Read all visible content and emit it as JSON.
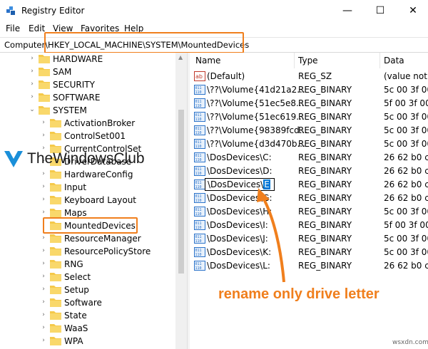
{
  "window": {
    "title": "Registry Editor",
    "min": "—",
    "max": "☐",
    "close": "✕"
  },
  "menu": [
    "File",
    "Edit",
    "View",
    "Favorites",
    "Help"
  ],
  "address": {
    "prefix": "Computer\\",
    "path": "HKEY_LOCAL_MACHINE\\SYSTEM\\MountedDevices"
  },
  "tree": [
    {
      "label": "HARDWARE",
      "level": 1,
      "chevron": "›"
    },
    {
      "label": "SAM",
      "level": 1,
      "chevron": "›"
    },
    {
      "label": "SECURITY",
      "level": 1,
      "chevron": "›"
    },
    {
      "label": "SOFTWARE",
      "level": 1,
      "chevron": "›"
    },
    {
      "label": "SYSTEM",
      "level": 1,
      "chevron": "⌄"
    },
    {
      "label": "ActivationBroker",
      "level": 2,
      "chevron": "›"
    },
    {
      "label": "ControlSet001",
      "level": 2,
      "chevron": "›"
    },
    {
      "label": "CurrentControlSet",
      "level": 2,
      "chevron": "›"
    },
    {
      "label": "DriverDatabase",
      "level": 2,
      "chevron": "›"
    },
    {
      "label": "HardwareConfig",
      "level": 2,
      "chevron": "›"
    },
    {
      "label": "Input",
      "level": 2,
      "chevron": "›"
    },
    {
      "label": "Keyboard Layout",
      "level": 2,
      "chevron": "›"
    },
    {
      "label": "Maps",
      "level": 2,
      "chevron": "›"
    },
    {
      "label": "MountedDevices",
      "level": 2,
      "chevron": ""
    },
    {
      "label": "ResourceManager",
      "level": 2,
      "chevron": "›"
    },
    {
      "label": "ResourcePolicyStore",
      "level": 2,
      "chevron": "›"
    },
    {
      "label": "RNG",
      "level": 2,
      "chevron": "›"
    },
    {
      "label": "Select",
      "level": 2,
      "chevron": "›"
    },
    {
      "label": "Setup",
      "level": 2,
      "chevron": "›"
    },
    {
      "label": "Software",
      "level": 2,
      "chevron": "›"
    },
    {
      "label": "State",
      "level": 2,
      "chevron": "›"
    },
    {
      "label": "WaaS",
      "level": 2,
      "chevron": "›"
    },
    {
      "label": "WPA",
      "level": 2,
      "chevron": "›"
    }
  ],
  "columns": {
    "name": "Name",
    "type": "Type",
    "data": "Data"
  },
  "values": [
    {
      "name": "(Default)",
      "type": "REG_SZ",
      "data": "(value not s",
      "icon": "string-value-icon"
    },
    {
      "name": "\\??\\Volume{41d21a2...",
      "type": "REG_BINARY",
      "data": "5c 00 3f 00 3",
      "icon": "binary-value-icon"
    },
    {
      "name": "\\??\\Volume{51ec5e8...",
      "type": "REG_BINARY",
      "data": "5f 00 3f 00 3",
      "icon": "binary-value-icon"
    },
    {
      "name": "\\??\\Volume{51ec619...",
      "type": "REG_BINARY",
      "data": "5c 00 3f 00 3",
      "icon": "binary-value-icon"
    },
    {
      "name": "\\??\\Volume{98389fcd...",
      "type": "REG_BINARY",
      "data": "5c 00 3f 00 3",
      "icon": "binary-value-icon"
    },
    {
      "name": "\\??\\Volume{d3d470b...",
      "type": "REG_BINARY",
      "data": "5c 00 3f 00 3",
      "icon": "binary-value-icon"
    },
    {
      "name": "\\DosDevices\\C:",
      "type": "REG_BINARY",
      "data": "26 62 b0 c4",
      "icon": "binary-value-icon"
    },
    {
      "name": "\\DosDevices\\D:",
      "type": "REG_BINARY",
      "data": "26 62 b0 c4",
      "icon": "binary-value-icon"
    },
    {
      "name": "\\DosDevices\\E:",
      "type": "REG_BINARY",
      "data": "26 62 b0 c4",
      "icon": "binary-value-icon",
      "rename": {
        "prefix": "\\DosDevices\\",
        "selected": "E"
      }
    },
    {
      "name": "\\DosDevices\\G:",
      "type": "REG_BINARY",
      "data": "26 62 b0 c4",
      "icon": "binary-value-icon"
    },
    {
      "name": "\\DosDevices\\H:",
      "type": "REG_BINARY",
      "data": "5c 00 3f 00 3",
      "icon": "binary-value-icon"
    },
    {
      "name": "\\DosDevices\\I:",
      "type": "REG_BINARY",
      "data": "5f 00 3f 00 3",
      "icon": "binary-value-icon"
    },
    {
      "name": "\\DosDevices\\J:",
      "type": "REG_BINARY",
      "data": "5c 00 3f 00 3",
      "icon": "binary-value-icon"
    },
    {
      "name": "\\DosDevices\\K:",
      "type": "REG_BINARY",
      "data": "5c 00 3f 00 3",
      "icon": "binary-value-icon"
    },
    {
      "name": "\\DosDevices\\L:",
      "type": "REG_BINARY",
      "data": "26 62 b0 c4",
      "icon": "binary-value-icon"
    }
  ],
  "watermark": {
    "text": "TheWindowsClub"
  },
  "annotation": "rename only drive letter",
  "site": "wsxdn.com",
  "colors": {
    "highlight": "#f07f1d",
    "selection": "#0078d7",
    "folder": "#f5c94a",
    "brand_blue": "#1a8fd9"
  }
}
